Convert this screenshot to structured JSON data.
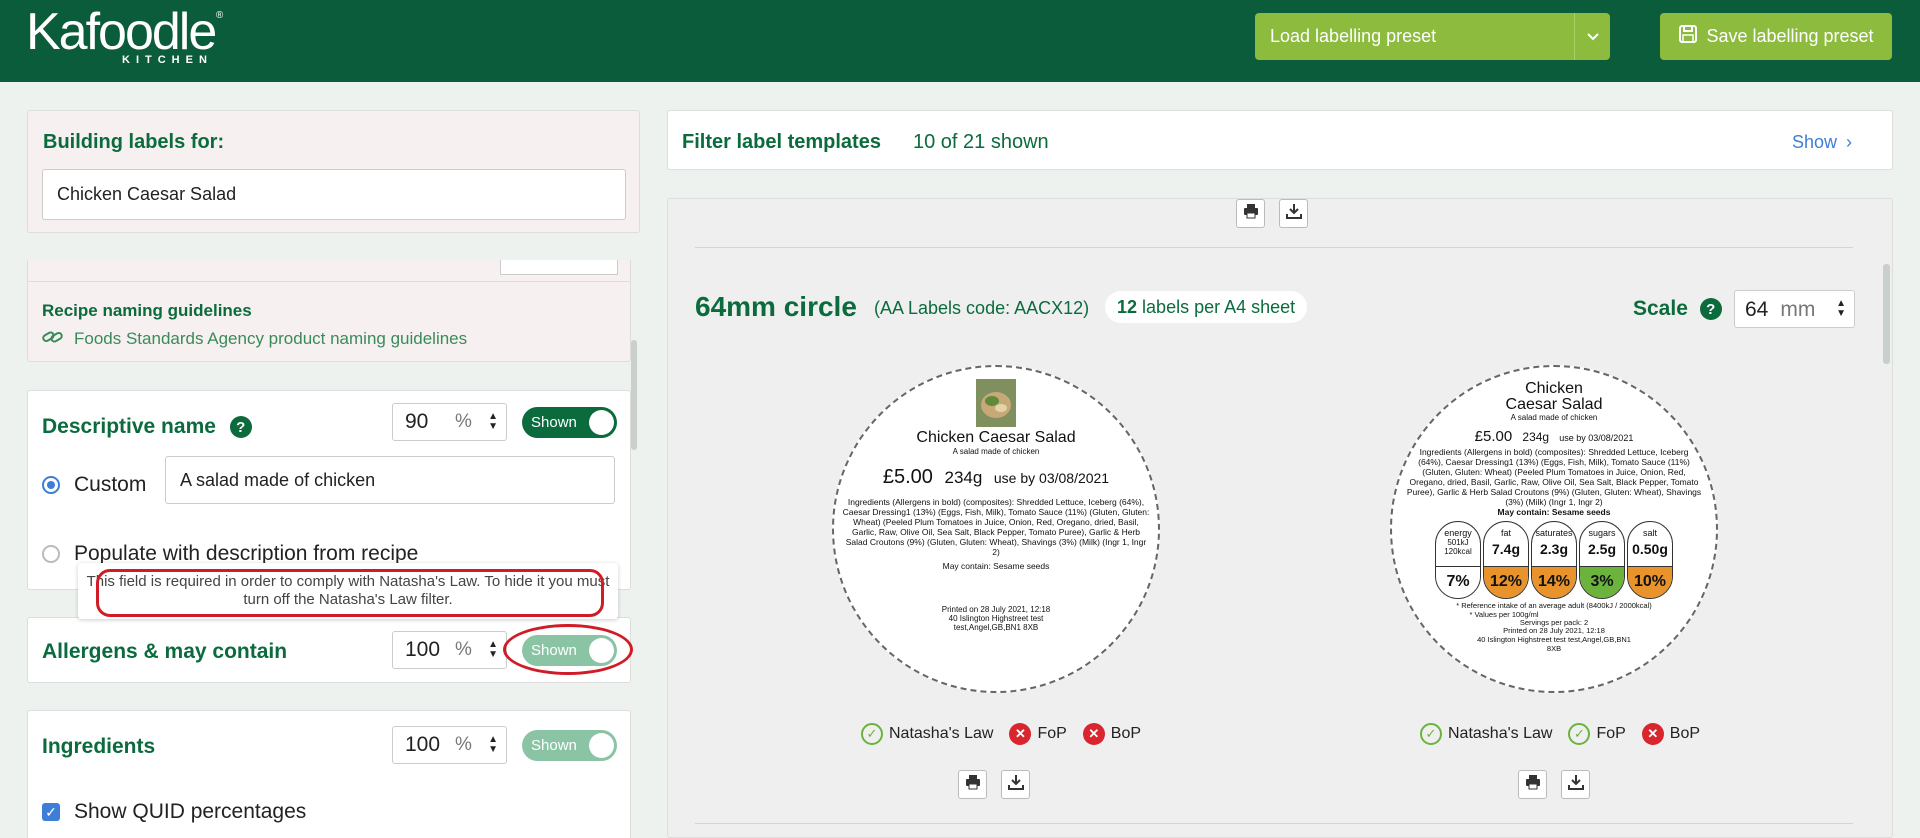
{
  "header": {
    "logo_text": "Kafoodle",
    "logo_sub": "KITCHEN",
    "preset_select_label": "Load labelling preset",
    "save_preset_label": "Save labelling preset"
  },
  "left": {
    "building_title": "Building labels for:",
    "recipe_name": "Chicken Caesar Salad",
    "naming_guidelines_title": "Recipe naming guidelines",
    "naming_guidelines_link": "Foods Standards Agency product naming guidelines",
    "descriptive": {
      "title": "Descriptive name",
      "percent": "90",
      "unit": "%",
      "toggle": "Shown",
      "custom_label": "Custom",
      "custom_value": "A salad made of chicken",
      "populate_label": "Populate with description from recipe"
    },
    "tooltip": "This field is required in order to comply with Natasha's Law. To hide it you must turn off the Natasha's Law filter.",
    "allergens": {
      "title": "Allergens & may contain",
      "percent": "100",
      "unit": "%",
      "toggle": "Shown"
    },
    "ingredients": {
      "title": "Ingredients",
      "percent": "100",
      "unit": "%",
      "toggle": "Shown",
      "quid_label": "Show QUID percentages"
    }
  },
  "right": {
    "filter_title": "Filter label templates",
    "filter_count": "10 of 21 shown",
    "filter_show": "Show",
    "template_title": "64mm circle",
    "template_code": "(AA Labels code: AACX12)",
    "per_sheet_num": "12",
    "per_sheet_text": "labels per A4 sheet",
    "scale_label": "Scale",
    "scale_value": "64",
    "scale_unit": "mm"
  },
  "label1": {
    "name": "Chicken Caesar Salad",
    "desc": "A salad made of chicken",
    "price": "£5.00",
    "weight": "234g",
    "useby": "use by 03/08/2021",
    "ingredients": "Ingredients (Allergens in bold) (composites): Shredded Lettuce, Iceberg (64%), Caesar Dressing1 (13%) (Eggs, Fish, Milk), Tomato Sauce (11%) (Gluten, Gluten: Wheat) (Peeled Plum Tomatoes in Juice, Onion, Red, Oregano, dried, Basil, Garlic, Raw, Olive Oil, Sea Salt, Black Pepper, Tomato Puree), Garlic & Herb Salad Croutons (9%) (Gluten, Gluten: Wheat), Shavings (3%) (Milk) (Ingr 1, Ingr 2)",
    "may_contain": "May contain: Sesame seeds",
    "printed": "Printed on 28 July 2021, 12:18",
    "address": "40 Islington Highstreet test test,Angel,GB,BN1 8XB",
    "filters": [
      "Natasha's Law",
      "FoP",
      "BoP"
    ]
  },
  "label2": {
    "name": "Chicken Caesar Salad",
    "desc": "A salad made of chicken",
    "price": "£5.00",
    "weight": "234g",
    "useby": "use by 03/08/2021",
    "ingredients": "Ingredients (Allergens in bold) (composites): Shredded Lettuce, Iceberg (64%), Caesar Dressing1 (13%) (Eggs, Fish, Milk), Tomato Sauce (11%) (Gluten, Gluten: Wheat) (Peeled Plum Tomatoes in Juice, Onion, Red, Oregano, dried, Basil, Garlic, Raw, Olive Oil, Sea Salt, Black Pepper, Tomato Puree), Garlic & Herb Salad Croutons (9%) (Gluten, Gluten: Wheat), Shavings (3%) (Milk) (Ingr 1, Ingr 2)",
    "may_contain": "May contain: Sesame seeds",
    "gda": [
      {
        "name": "energy",
        "amount": "501kJ 120kcal",
        "pct": "7%",
        "color": "#ffffff"
      },
      {
        "name": "fat",
        "amount": "7.4g",
        "pct": "12%",
        "color": "#e8932b"
      },
      {
        "name": "saturates",
        "amount": "2.3g",
        "pct": "14%",
        "color": "#e8932b"
      },
      {
        "name": "sugars",
        "amount": "2.5g",
        "pct": "3%",
        "color": "#6cb33e"
      },
      {
        "name": "salt",
        "amount": "0.50g",
        "pct": "10%",
        "color": "#e8932b"
      }
    ],
    "ri_note": "* Reference intake of an average adult (8400kJ / 2000kcal)",
    "values_note": "* Values per 100g/ml",
    "servings": "Servings per pack: 2",
    "printed": "Printed on 28 July 2021, 12:18",
    "address": "40 Islington Highstreet test test,Angel,GB,BN1 8XB",
    "filters": [
      "Natasha's Law",
      "FoP",
      "BoP"
    ]
  },
  "colors": {
    "brand_green": "#0b5c3a",
    "accent_lime": "#8cbb3e",
    "annotation_red": "#d01c26"
  }
}
